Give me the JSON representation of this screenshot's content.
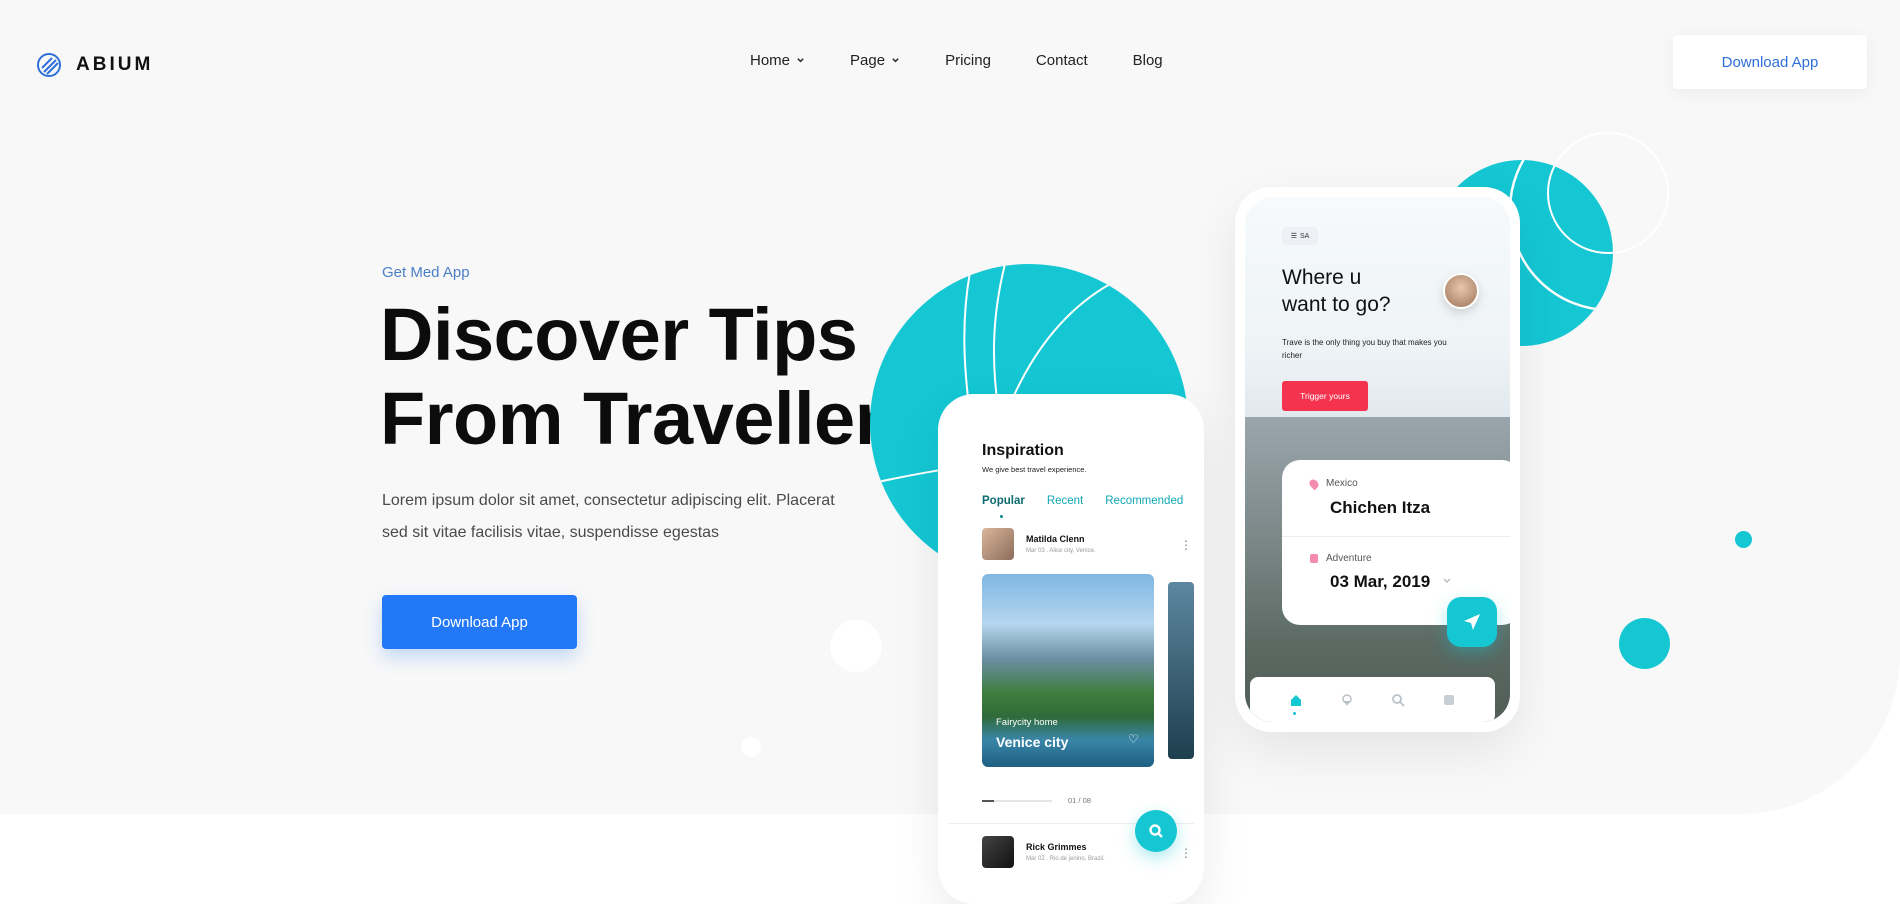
{
  "header": {
    "logo": "ABIUM",
    "nav": [
      {
        "label": "Home",
        "dropdown": true
      },
      {
        "label": "Page",
        "dropdown": true
      },
      {
        "label": "Pricing",
        "dropdown": false
      },
      {
        "label": "Contact",
        "dropdown": false
      },
      {
        "label": "Blog",
        "dropdown": false
      }
    ],
    "cta": "Download App"
  },
  "hero": {
    "eyebrow": "Get Med App",
    "title_line1": "Discover Tips",
    "title_line2": "From Travellers",
    "desc": "Lorem ipsum dolor sit amet, consectetur adipiscing elit. Placerat sed sit vitae facilisis vitae, suspendisse egestas",
    "cta": "Download App"
  },
  "phone_left": {
    "title": "Inspiration",
    "subtitle": "We give best travel experience.",
    "tabs": [
      "Popular",
      "Recent",
      "Recommended"
    ],
    "post1": {
      "name": "Matilda Clenn",
      "meta": "Mar 03 . Alice city, Venice."
    },
    "card": {
      "subtitle": "Fairycity home",
      "title": "Venice city"
    },
    "pagination": "01 / 08",
    "post2": {
      "name": "Rick Grimmes",
      "meta": "Mar 02 . Rio de jenino, Brazil."
    }
  },
  "phone_right": {
    "menu": "SA",
    "headline_line1": "Where u",
    "headline_line2": "want to go?",
    "text": "Trave is the only thing you buy that makes you richer",
    "button": "Trigger yours",
    "location_label": "Mexico",
    "location_name": "Chichen Itza",
    "category_label": "Adventure",
    "date": "03 Mar, 2019"
  },
  "colors": {
    "accent": "#14c7d3",
    "primary": "#2378f7",
    "link": "#2f6fd9",
    "danger": "#f5334f"
  }
}
